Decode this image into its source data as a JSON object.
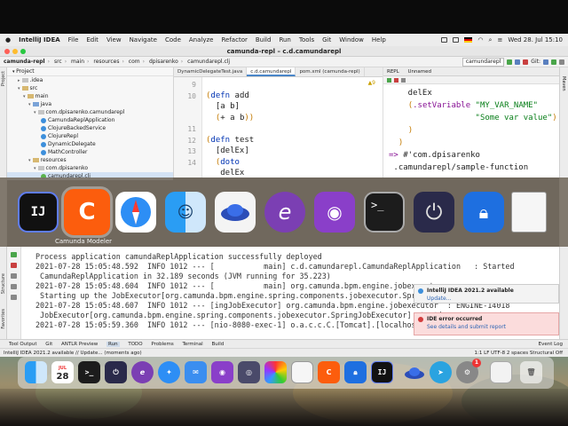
{
  "menubar": {
    "items": [
      "IntelliJ IDEA",
      "File",
      "Edit",
      "View",
      "Navigate",
      "Code",
      "Analyze",
      "Refactor",
      "Build",
      "Run",
      "Tools",
      "Git",
      "Window",
      "Help"
    ],
    "clock": "Wed 28. Jul  15:10"
  },
  "window": {
    "title": "camunda-repl – c.d.camundarepl"
  },
  "navbar": {
    "breadcrumbs": [
      "camunda-repl",
      "src",
      "main",
      "resources",
      "com",
      "dpisarenko",
      "camundarepl.clj"
    ],
    "run_config": "camundarepl",
    "git_label": "Git:"
  },
  "project": {
    "header": "Project",
    "tree": [
      {
        "label": ".idea",
        "indent": 2,
        "icon": "folder-gray",
        "arrow": "▸"
      },
      {
        "label": "src",
        "indent": 2,
        "icon": "folder-yellow",
        "arrow": "▾"
      },
      {
        "label": "main",
        "indent": 3,
        "icon": "folder-yellow",
        "arrow": "▾"
      },
      {
        "label": "java",
        "indent": 4,
        "icon": "folder-blue",
        "arrow": "▾"
      },
      {
        "label": "com.dpisarenko.camundarepl",
        "indent": 5,
        "icon": "folder-gray",
        "arrow": "▾"
      },
      {
        "label": "CamundaReplApplication",
        "indent": 6,
        "icon": "class",
        "arrow": ""
      },
      {
        "label": "ClojureBackedService",
        "indent": 6,
        "icon": "class",
        "arrow": ""
      },
      {
        "label": "ClojureRepl",
        "indent": 6,
        "icon": "class",
        "arrow": ""
      },
      {
        "label": "DynamicDelegate",
        "indent": 6,
        "icon": "class",
        "arrow": ""
      },
      {
        "label": "MathController",
        "indent": 6,
        "icon": "class",
        "arrow": ""
      },
      {
        "label": "resources",
        "indent": 4,
        "icon": "folder-yellow",
        "arrow": "▾"
      },
      {
        "label": "com.dpisarenko",
        "indent": 5,
        "icon": "folder-gray",
        "arrow": "▾"
      },
      {
        "label": "camundarepl.clj",
        "indent": 6,
        "icon": "clj",
        "arrow": "",
        "selected": true
      }
    ]
  },
  "editor": {
    "tabs": [
      {
        "label": "DynamicDelegateTest.java",
        "active": false
      },
      {
        "label": "c.d.camundarepl",
        "active": true
      },
      {
        "label": "pom.xml (camunda-repl)",
        "active": false
      }
    ],
    "inspection": "▲9",
    "lines": [
      {
        "n": "9",
        "text": ""
      },
      {
        "n": "10",
        "text": "(defn add"
      },
      {
        "n": "",
        "text": "  [a b]"
      },
      {
        "n": "",
        "text": "  (+ a b))"
      },
      {
        "n": "11",
        "text": ""
      },
      {
        "n": "12",
        "text": "(defn test"
      },
      {
        "n": "13",
        "text": "  [delEx]"
      },
      {
        "n": "14",
        "text": "  (doto"
      },
      {
        "n": "",
        "text": "   delEx"
      }
    ]
  },
  "repl": {
    "tabs": [
      "REPL",
      "Unnamed"
    ],
    "lines": [
      "    delEx",
      "    (.setVariable \"MY_VAR_NAME\"",
      "                  \"Some var value\")",
      "    )",
      "  )",
      "=> #'com.dpisarenko",
      " .camundarepl/sample-function"
    ]
  },
  "switcher": {
    "hovered_app": "Camunda Modeler"
  },
  "console": {
    "lines": [
      "Process application camundaReplApplication successfully deployed",
      "2021-07-28 15:05:48.592  INFO 1012 --- [           main] c.d.camundarepl.CamundaReplApplication   : Started",
      " CamundaReplApplication in 32.189 seconds (JVM running for 35.223)",
      "2021-07-28 15:05:48.604  INFO 1012 --- [           main] org.camunda.bpm.engine.jobexecutor",
      " Starting up the JobExecutor[org.camunda.bpm.engine.spring.components.jobexecutor.SpringJobExecutor].",
      "2021-07-28 15:05:48.607  INFO 1012 --- [ingJobExecutor] org.camunda.bpm.engine.jobexecutor  : ENGINE-14018",
      " JobExecutor[org.camunda.bpm.engine.spring.components.jobexecutor.SpringJobExecutor] starting",
      "2021-07-28 15:05:59.360  INFO 1012 --- [nio-8080-exec-1] o.a.c.c.C.[Tomcat].[localhost]"
    ]
  },
  "notifications": [
    {
      "title": "IntelliJ IDEA 2021.2 available",
      "link": "Update...",
      "kind": "info"
    },
    {
      "title": "IDE error occurred",
      "link": "See details and submit report",
      "kind": "error"
    }
  ],
  "bottom_tabs": [
    "Tool Output",
    "Git",
    "ANTLR Preview",
    "Run",
    "TODO",
    "Problems",
    "Terminal",
    "Build"
  ],
  "bottom_right": "Event Log",
  "status": {
    "left": "IntelliJ IDEA 2021.2 available // Update... (moments ago)",
    "right": "1:1   LF   UTF-8   2 spaces   Structural Off"
  },
  "dock": {
    "calendar_day": "28",
    "calendar_month": "JUL",
    "badge": "1"
  },
  "colors": {
    "accent": "#4a86c8",
    "error_bg": "#fbdcdc",
    "switcher_bg": "#787064"
  }
}
